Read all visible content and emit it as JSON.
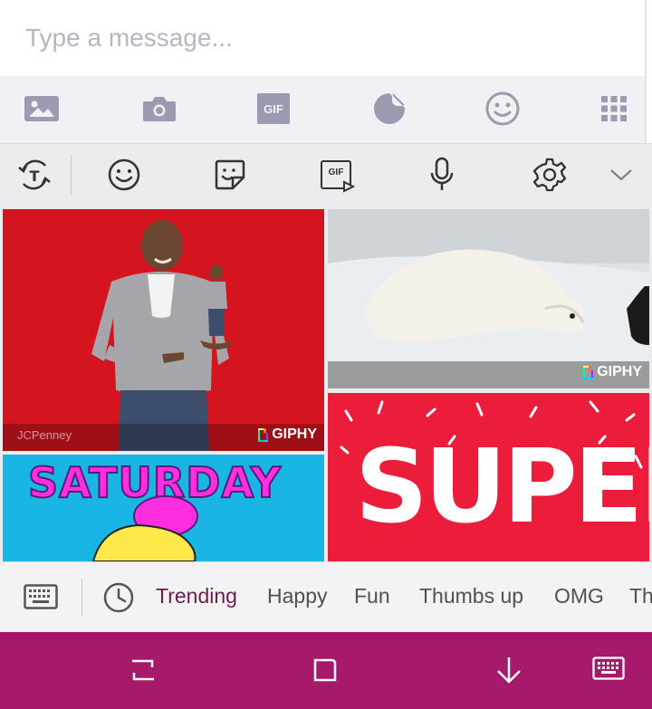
{
  "composer": {
    "placeholder": "Type a message..."
  },
  "attachments": {
    "items": [
      {
        "icon": "gallery-icon",
        "label": "Gallery"
      },
      {
        "icon": "camera-icon",
        "label": "Camera"
      },
      {
        "icon": "gif-icon",
        "label": "GIF"
      },
      {
        "icon": "sticker-icon",
        "label": "Sticker"
      },
      {
        "icon": "emoji-icon",
        "label": "Emoji"
      },
      {
        "icon": "more-apps-icon",
        "label": "More"
      }
    ],
    "gif_label": "GIF"
  },
  "keyboard_toolbar": {
    "items": [
      "translate-icon",
      "emoji-icon",
      "sticker-icon",
      "gif-icon",
      "microphone-icon",
      "settings-icon",
      "collapse-chevron-icon"
    ],
    "gif_label": "GIF"
  },
  "gifs": [
    {
      "subject": "man pointing, red background",
      "caption": "JCPenney",
      "badge": "GIPHY"
    },
    {
      "subject": "polar bear sleeping on snow",
      "badge": "GIPHY"
    },
    {
      "subject": "SATURDAY text animation",
      "text": "SATURDAY"
    },
    {
      "subject": "SUPER text animation",
      "text": "SUPER"
    }
  ],
  "categories": {
    "items": [
      "Trending",
      "Happy",
      "Fun",
      "Thumbs up",
      "OMG",
      "Th"
    ],
    "active_index": 0,
    "active_color": "#6e1b4c"
  },
  "navigation": {
    "background": "#a7196b",
    "items": [
      "recent-apps-icon",
      "home-icon",
      "back-icon",
      "hide-keyboard-icon"
    ]
  },
  "colors": {
    "giphy_red": "#d4141e",
    "saturday_blue": "#19b6e3",
    "super_red": "#ec1d3b"
  }
}
